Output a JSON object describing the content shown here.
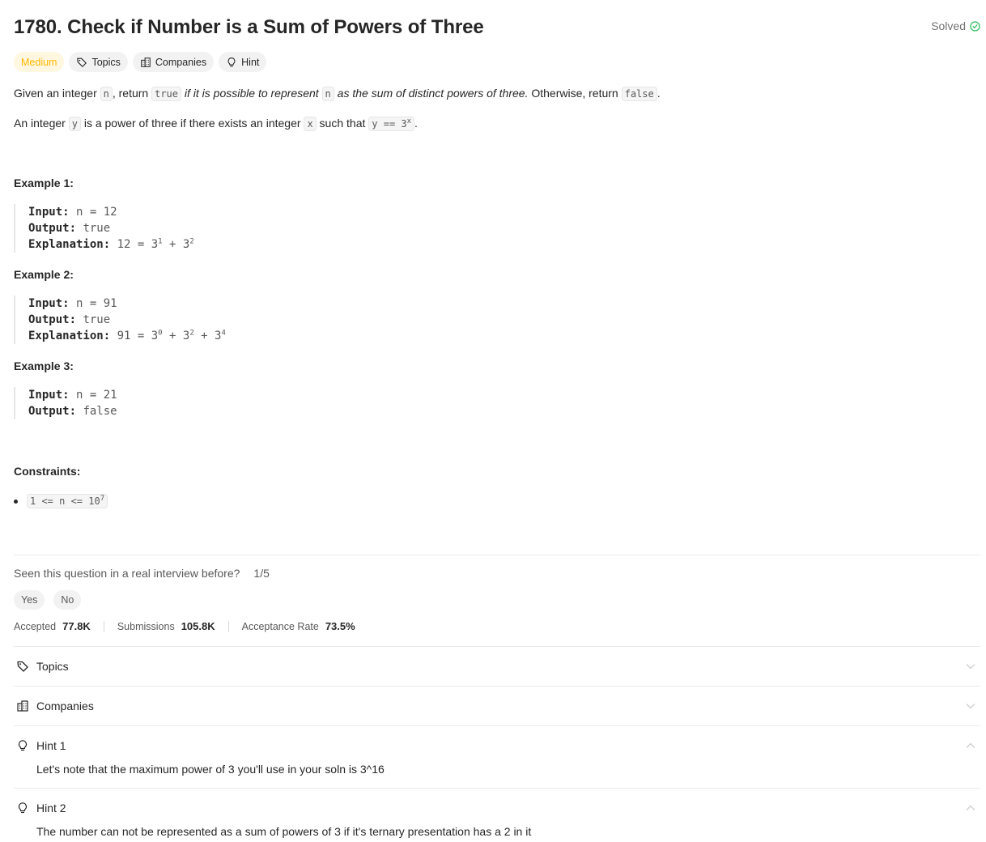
{
  "problem": {
    "title": "1780. Check if Number is a Sum of Powers of Three",
    "status": "Solved"
  },
  "tags": {
    "difficulty": "Medium",
    "topics": "Topics",
    "companies": "Companies",
    "hint": "Hint"
  },
  "description": {
    "p1": [
      "Given an integer ",
      "n",
      ", return ",
      "true",
      " ",
      "if it is possible to represent ",
      "n",
      " as the sum of distinct powers of three.",
      " Otherwise, return ",
      "false",
      "."
    ],
    "p2": [
      "An integer ",
      "y",
      " is a power of three if there exists an integer ",
      "x",
      " such that ",
      "y == 3",
      "x",
      "."
    ]
  },
  "examples": [
    {
      "title": "Example 1:",
      "input_label": "Input:",
      "input": "n = 12",
      "output_label": "Output:",
      "output": "true",
      "explanation_label": "Explanation:",
      "explanation": [
        "12 = 3",
        "1",
        " + 3",
        "2"
      ]
    },
    {
      "title": "Example 2:",
      "input_label": "Input:",
      "input": "n = 91",
      "output_label": "Output:",
      "output": "true",
      "explanation_label": "Explanation:",
      "explanation": [
        "91 = 3",
        "0",
        " + 3",
        "2",
        " + 3",
        "4"
      ]
    },
    {
      "title": "Example 3:",
      "input_label": "Input:",
      "input": "n = 21",
      "output_label": "Output:",
      "output": "false"
    }
  ],
  "constraints": {
    "title": "Constraints:",
    "items": [
      {
        "text": "1 <= n <= 10",
        "sup": "7"
      }
    ]
  },
  "interview": {
    "question": "Seen this question in a real interview before?",
    "count": "1/5",
    "yes": "Yes",
    "no": "No"
  },
  "stats": {
    "accepted_label": "Accepted",
    "accepted": "77.8K",
    "submissions_label": "Submissions",
    "submissions": "105.8K",
    "rate_label": "Acceptance Rate",
    "rate": "73.5%"
  },
  "accordion": {
    "topics": "Topics",
    "companies": "Companies",
    "hint1_title": "Hint 1",
    "hint1_body": "Let's note that the maximum power of 3 you'll use in your soln is 3^16",
    "hint2_title": "Hint 2",
    "hint2_body": "The number can not be represented as a sum of powers of 3 if it's ternary presentation has a 2 in it"
  },
  "colors": {
    "medium": "#ffb800",
    "solved_check": "#2cbb5d",
    "text": "#262626",
    "muted": "#595959"
  },
  "icons": [
    "check-circle-icon",
    "tag-icon",
    "building-icon",
    "lightbulb-icon",
    "chevron-down-icon",
    "chevron-up-icon"
  ]
}
